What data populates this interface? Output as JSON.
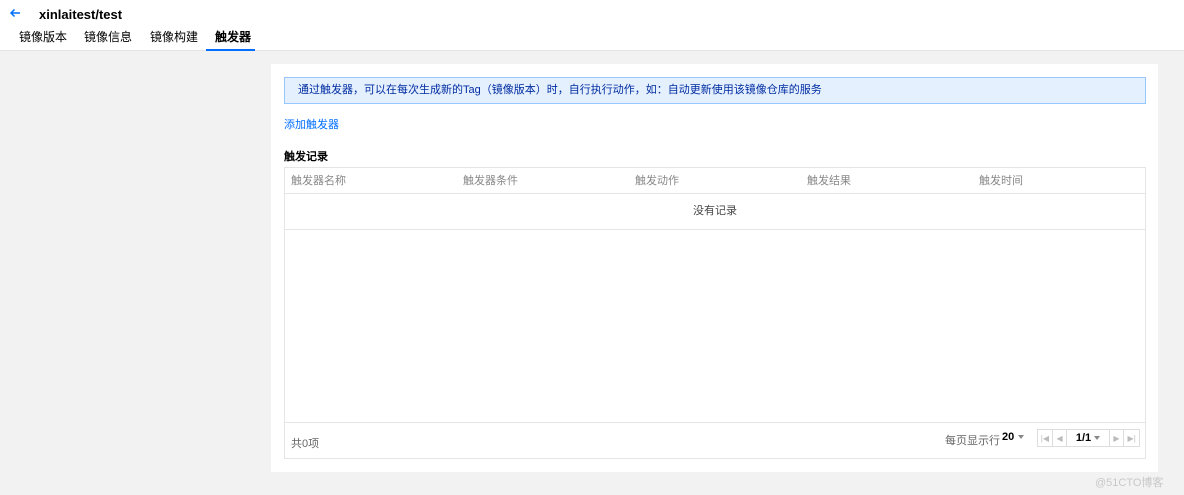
{
  "header": {
    "back_icon": "arrow-left-icon",
    "title": "xinlaitest/test",
    "tabs": [
      {
        "label": "镜像版本",
        "active": false
      },
      {
        "label": "镜像信息",
        "active": false
      },
      {
        "label": "镜像构建",
        "active": false
      },
      {
        "label": "触发器",
        "active": true
      }
    ]
  },
  "main": {
    "tip": "通过触发器，可以在每次生成新的Tag（镜像版本）时，自行执行动作，如：自动更新使用该镜像仓库的服务",
    "add_link": "添加触发器",
    "section_title": "触发记录",
    "table": {
      "columns": [
        "触发器名称",
        "触发器条件",
        "触发动作",
        "触发结果",
        "触发时间"
      ],
      "empty_text": "没有记录",
      "rows": []
    },
    "pagination": {
      "total": "共0项",
      "per_page_label": "每页显示行",
      "per_page_value": "20",
      "page": "1/1"
    }
  },
  "watermark": "@51CTO博客",
  "colors": {
    "accent": "#006eff",
    "tip_bg": "#e5f0ff",
    "tip_border": "#97c7ff",
    "page_bg": "#f2f2f2"
  }
}
